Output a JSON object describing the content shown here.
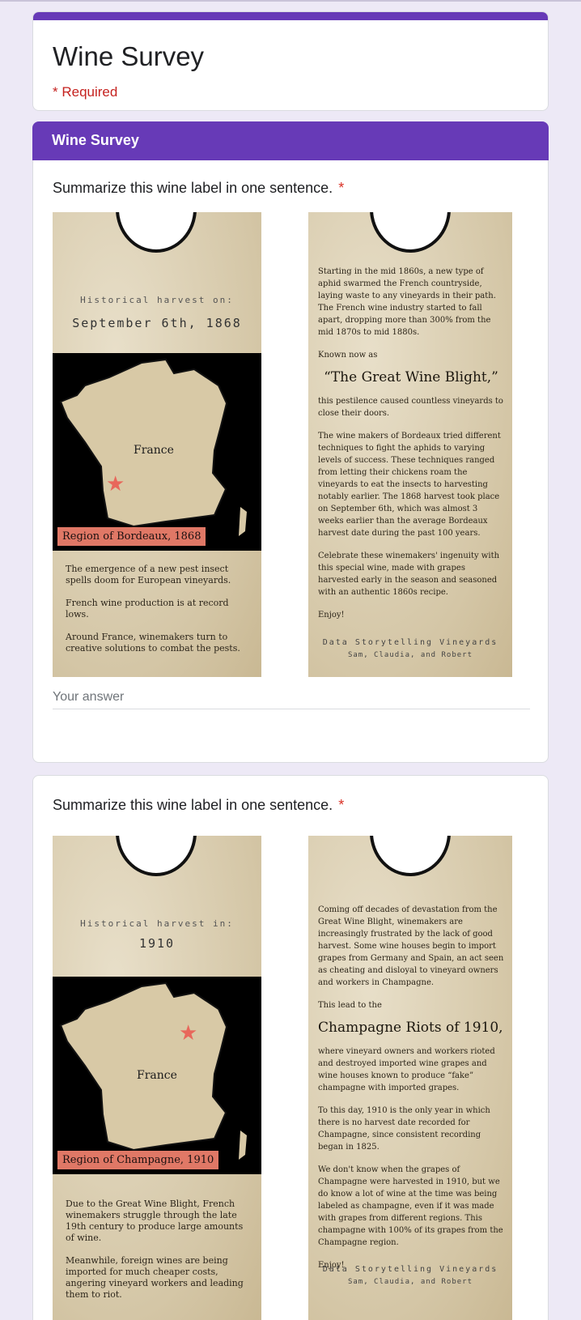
{
  "form": {
    "title": "Wine Survey",
    "required_note": "* Required"
  },
  "section": {
    "title": "Wine Survey"
  },
  "questions": [
    {
      "title": "Summarize this wine label in one sentence.",
      "required_mark": "*",
      "answer_placeholder": "Your answer",
      "label": {
        "harvest_line1": "Historical harvest on:",
        "harvest_line2": "September 6th, 1868",
        "map_country": "France",
        "region": "Region of Bordeaux, 1868",
        "front_paragraphs": [
          "The emergence of a new pest insect spells doom for European vineyards.",
          "French wine production is at record lows.",
          "Around France, winemakers turn to creative solutions to combat the pests."
        ],
        "back_intro": "Starting in the mid 1860s, a new type of aphid swarmed the French countryside, laying waste to any vineyards in their path. The French wine industry started to fall apart, dropping more than 300% from the mid 1870s to mid 1880s.",
        "back_known": "Known now as",
        "back_headline": "“The Great Wine Blight,”",
        "back_after": "this pestilence caused countless vineyards to close their doors.",
        "back_body": "The wine makers of Bordeaux tried different techniques to fight the aphids to varying levels of success. These techniques ranged from letting their chickens roam the vineyards to eat the insects to harvesting notably earlier. The 1868 harvest took place on September 6th, which was almost 3 weeks earlier than the average Bordeaux harvest date during the past 100 years.",
        "back_celebrate": "Celebrate these winemakers' ingenuity with this special wine, made with grapes harvested early in the season and seasoned with an authentic 1860s recipe.",
        "back_enjoy": "Enjoy!",
        "signature_line1": "Data Storytelling Vineyards",
        "signature_line2": "Sam, Claudia, and Robert"
      }
    },
    {
      "title": "Summarize this wine label in one sentence.",
      "required_mark": "*",
      "label": {
        "harvest_line1": "Historical harvest in:",
        "harvest_line2": "1910",
        "map_country": "France",
        "region": "Region of Champagne, 1910",
        "front_paragraphs": [
          "Due to the Great Wine Blight, French winemakers struggle through the late 19th century to produce large amounts of wine.",
          "Meanwhile, foreign wines are being imported for much cheaper costs, angering vineyard workers and leading them to riot."
        ],
        "back_intro": "Coming off decades of devastation from the Great Wine Blight, winemakers are increasingly frustrated by the lack of good harvest. Some wine houses begin to import grapes from Germany and Spain, an act seen as cheating and disloyal to vineyard owners and workers in Champagne.",
        "back_known": "This lead to the",
        "back_headline": "Champagne Riots of 1910,",
        "back_after": "where vineyard owners and workers rioted and destroyed imported wine grapes and wine houses known to produce “fake” champagne with imported grapes.",
        "back_body": "To this day, 1910 is the only year in which there is no harvest date recorded for Champagne, since consistent recording began in 1825.",
        "back_celebrate": "We don't know when the grapes of Champagne were harvested in 1910, but we do know a lot of wine at the time was being labeled as champagne, even if it was made with grapes from different regions. This champagne with 100% of its grapes from the Champagne region.",
        "back_enjoy": "Enjoy!",
        "signature_line1": "Data Storytelling Vineyards",
        "signature_line2": "Sam, Claudia, and Robert"
      }
    }
  ],
  "colors": {
    "accent": "#673ab7",
    "required": "#d93025",
    "background": "#ede9f6",
    "region_badge": "#e07866",
    "star": "#e8675b"
  }
}
